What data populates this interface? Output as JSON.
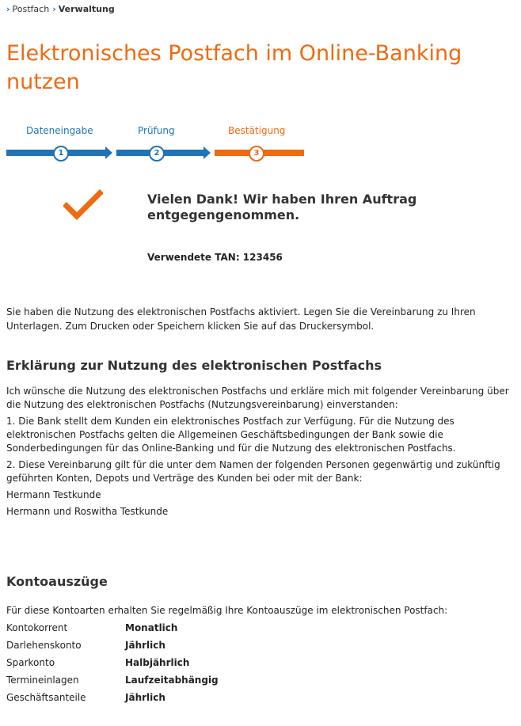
{
  "breadcrumb": {
    "items": [
      "Postfach",
      "Verwaltung"
    ]
  },
  "title": "Elektronisches Postfach im Online-Banking nutzen",
  "stepper": {
    "steps": [
      {
        "label": "Dateneingabe",
        "number": "1"
      },
      {
        "label": "Prüfung",
        "number": "2"
      },
      {
        "label": "Bestätigung",
        "number": "3"
      }
    ],
    "current_step": 3,
    "colors": {
      "done": "#1f73b7",
      "active": "#f06a0f"
    }
  },
  "confirmation": {
    "icon": "checkmark-icon",
    "message": "Vielen Dank! Wir haben Ihren Auftrag entgegengenommen.",
    "tan": "Verwendete TAN: 123456"
  },
  "intro": "Sie haben die Nutzung des elektronischen Postfachs aktiviert. Legen Sie die Vereinbarung zu Ihren Unterlagen. Zum Drucken oder Speichern klicken Sie auf das Druckersymbol.",
  "declaration": {
    "heading": "Erklärung zur Nutzung des elektronischen Postfachs",
    "paragraphs": [
      "Ich wünsche die Nutzung des elektronischen Postfachs und erkläre mich mit folgender Vereinbarung über die Nutzung des elektronischen Postfachs (Nutzungsvereinbarung) einverstanden:",
      "1. Die Bank stellt dem Kunden ein elektronisches Postfach zur Verfügung. Für die Nutzung des elektronischen Postfachs gelten die Allgemeinen Geschäftsbedingungen der Bank sowie die Sonderbedingungen für das Online-Banking und für die Nutzung des elektronischen Postfachs.",
      "2. Diese Vereinbarung gilt für die unter dem Namen der folgenden Personen gegenwärtig und zukünftig geführten Konten, Depots und Verträge des Kunden bei oder mit der Bank:",
      "Hermann Testkunde",
      "Hermann und Roswitha Testkunde"
    ]
  },
  "statements": {
    "heading": "Kontoauszüge",
    "intro": "Für diese Kontoarten erhalten Sie regelmäßig Ihre Kontoauszüge im elektronischen Postfach:",
    "rows": [
      {
        "type": "Kontokorrent",
        "frequency": "Monatlich"
      },
      {
        "type": "Darlehenskonto",
        "frequency": "Jährlich"
      },
      {
        "type": "Sparkonto",
        "frequency": "Halbjährlich"
      },
      {
        "type": "Termineinlagen",
        "frequency": "Laufzeitabhängig"
      },
      {
        "type": "Geschäftsanteile",
        "frequency": "Jährlich"
      }
    ]
  }
}
